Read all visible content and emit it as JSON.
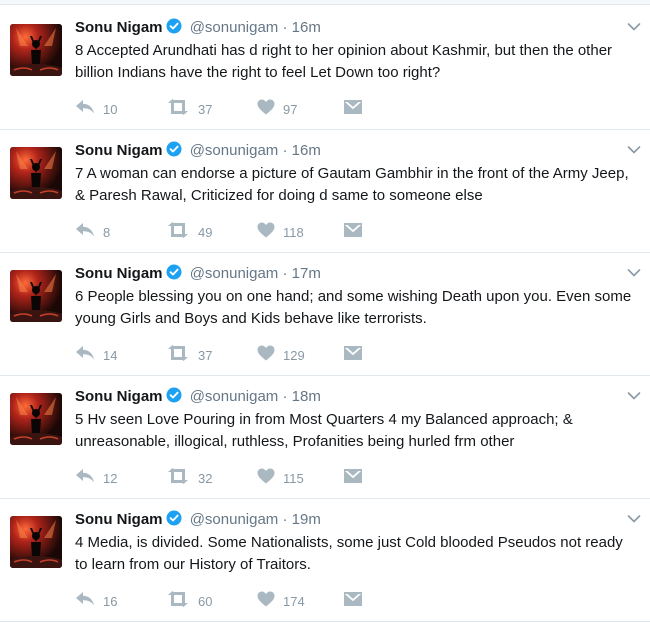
{
  "tweets": [
    {
      "name": "Sonu Nigam",
      "handle": "@sonunigam",
      "separator": "·",
      "time": "16m",
      "text": "8 Accepted Arundhati has d right to her opinion about Kashmir, but then the other billion Indians have the right to feel Let Down too right?",
      "replies": "10",
      "retweets": "37",
      "likes": "97"
    },
    {
      "name": "Sonu Nigam",
      "handle": "@sonunigam",
      "separator": "·",
      "time": "16m",
      "text": "7 A woman can endorse a picture of Gautam Gambhir in the front of the Army Jeep, & Paresh Rawal, Criticized for doing d same to someone else",
      "replies": "8",
      "retweets": "49",
      "likes": "118"
    },
    {
      "name": "Sonu Nigam",
      "handle": "@sonunigam",
      "separator": "·",
      "time": "17m",
      "text": "6 People blessing you on one hand; and some wishing Death upon you. Even some young Girls and Boys and Kids behave like terrorists.",
      "replies": "14",
      "retweets": "37",
      "likes": "129"
    },
    {
      "name": "Sonu Nigam",
      "handle": "@sonunigam",
      "separator": "·",
      "time": "18m",
      "text": "5 Hv seen Love Pouring in from Most Quarters 4 my Balanced approach; & unreasonable, illogical, ruthless, Profanities being hurled frm other",
      "replies": "12",
      "retweets": "32",
      "likes": "115"
    },
    {
      "name": "Sonu Nigam",
      "handle": "@sonunigam",
      "separator": "·",
      "time": "19m",
      "text": "4 Media, is divided. Some Nationalists, some just Cold blooded Pseudos not ready to learn from our History of Traitors.",
      "replies": "16",
      "retweets": "60",
      "likes": "174"
    }
  ],
  "icons": {
    "reply": "reply-icon",
    "retweet": "retweet-icon",
    "like": "heart-icon",
    "dm": "envelope-icon",
    "verified": "verified-badge-icon",
    "caret": "chevron-down-icon"
  },
  "colors": {
    "verified": "#1da1f2",
    "icon_gray": "#aab8c2",
    "meta_gray": "#657786",
    "border": "#e1e8ed"
  }
}
